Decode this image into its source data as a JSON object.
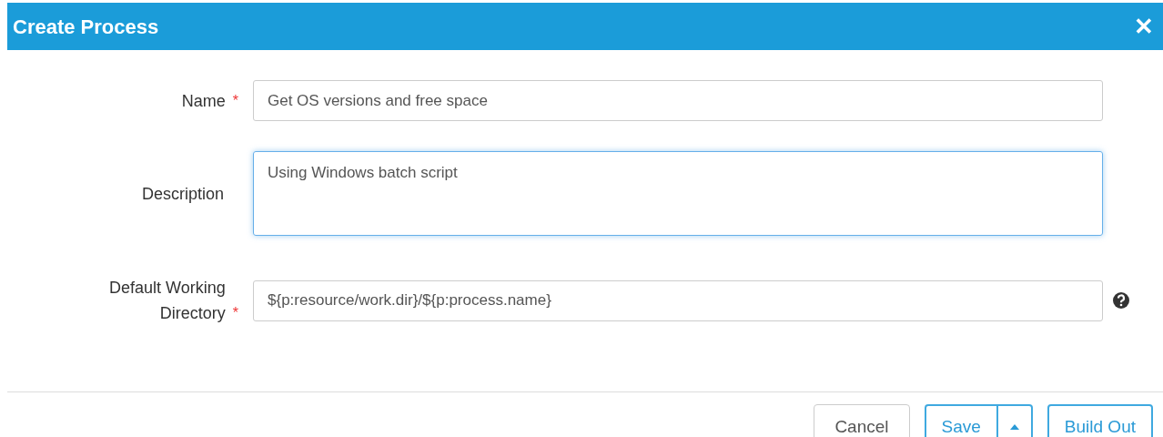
{
  "dialog": {
    "title": "Create Process",
    "close": "✕"
  },
  "fields": [
    {
      "label": "Name",
      "required_mark": "*",
      "kind": "input",
      "value": "Get OS versions and free space",
      "focused": false,
      "help": false
    },
    {
      "label": "Description",
      "kind": "textarea",
      "value": "Using Windows batch script",
      "focused": true,
      "help": false
    },
    {
      "label": "Default Working Directory",
      "required_mark": "*",
      "kind": "input",
      "value": "${p:resource/work.dir}/${p:process.name}",
      "focused": false,
      "help": true
    }
  ],
  "buttons": [
    {
      "label": "Cancel",
      "kind": "default"
    },
    {
      "label": "Save",
      "kind": "split"
    },
    {
      "label": "Build Out",
      "kind": "primary"
    }
  ]
}
